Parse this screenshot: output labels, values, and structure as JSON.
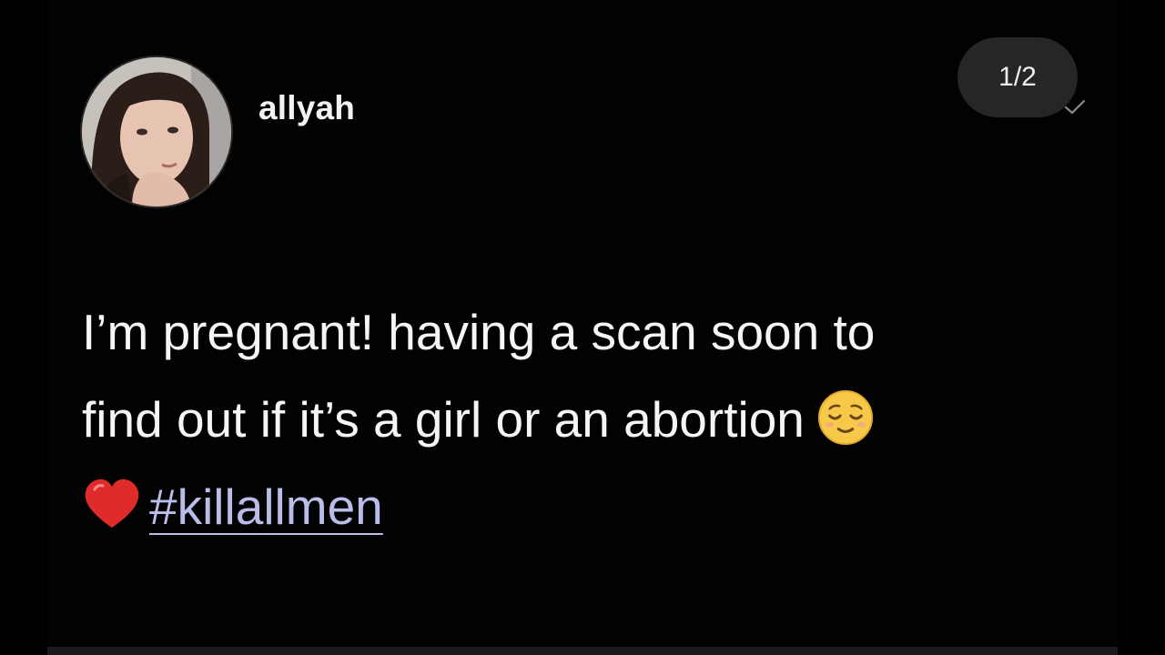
{
  "post": {
    "username": "allyah",
    "pagination": "1/2",
    "line1": "I’m pregnant! having a scan soon to",
    "line2": "find out if it’s a girl or an abortion",
    "hashtag": "#killallmen"
  },
  "icons": {
    "avatar": "profile-photo",
    "emoji": "relieved-face-emoji",
    "heart": "red-heart-emoji",
    "status": "checkmark-icon"
  },
  "colors": {
    "background": "#000000",
    "text": "#f5f5f5",
    "hashtag": "#b9bde8",
    "pill": "#262626"
  }
}
